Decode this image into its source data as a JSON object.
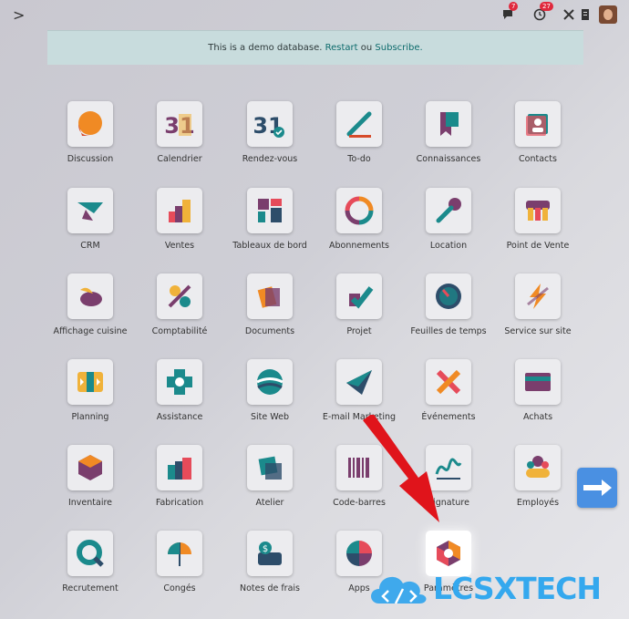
{
  "topbar": {
    "chat_badge": "7",
    "activity_badge": "27"
  },
  "demo_banner": {
    "text": "This is a demo database.",
    "link1": "Restart",
    "sep": "ou",
    "link2": "Subscribe."
  },
  "apps": [
    {
      "label": "Discussion",
      "icon": "discussion-icon"
    },
    {
      "label": "Calendrier",
      "icon": "calendar-icon"
    },
    {
      "label": "Rendez-vous",
      "icon": "appointment-icon"
    },
    {
      "label": "To-do",
      "icon": "todo-icon"
    },
    {
      "label": "Connaissances",
      "icon": "knowledge-icon"
    },
    {
      "label": "Contacts",
      "icon": "contacts-icon"
    },
    {
      "label": "CRM",
      "icon": "crm-icon"
    },
    {
      "label": "Ventes",
      "icon": "sales-icon"
    },
    {
      "label": "Tableaux de bord",
      "icon": "dashboard-icon"
    },
    {
      "label": "Abonnements",
      "icon": "subscription-icon"
    },
    {
      "label": "Location",
      "icon": "rental-icon"
    },
    {
      "label": "Point de Vente",
      "icon": "pos-icon"
    },
    {
      "label": "Affichage cuisine",
      "icon": "kitchen-icon"
    },
    {
      "label": "Comptabilité",
      "icon": "accounting-icon"
    },
    {
      "label": "Documents",
      "icon": "documents-icon"
    },
    {
      "label": "Projet",
      "icon": "project-icon"
    },
    {
      "label": "Feuilles de temps",
      "icon": "timesheet-icon"
    },
    {
      "label": "Service sur site",
      "icon": "field-service-icon"
    },
    {
      "label": "Planning",
      "icon": "planning-icon"
    },
    {
      "label": "Assistance",
      "icon": "helpdesk-icon"
    },
    {
      "label": "Site Web",
      "icon": "website-icon"
    },
    {
      "label": "E-mail Marketing",
      "icon": "email-marketing-icon"
    },
    {
      "label": "Événements",
      "icon": "events-icon"
    },
    {
      "label": "Achats",
      "icon": "purchase-icon"
    },
    {
      "label": "Inventaire",
      "icon": "inventory-icon"
    },
    {
      "label": "Fabrication",
      "icon": "manufacturing-icon"
    },
    {
      "label": "Atelier",
      "icon": "workshop-icon"
    },
    {
      "label": "Code-barres",
      "icon": "barcode-icon"
    },
    {
      "label": "Signature",
      "icon": "signature-icon"
    },
    {
      "label": "Employés",
      "icon": "employees-icon"
    },
    {
      "label": "Recrutement",
      "icon": "recruitment-icon"
    },
    {
      "label": "Congés",
      "icon": "time-off-icon"
    },
    {
      "label": "Notes de frais",
      "icon": "expenses-icon"
    },
    {
      "label": "Apps",
      "icon": "apps-icon"
    },
    {
      "label": "Paramètres",
      "icon": "settings-icon"
    }
  ],
  "watermark": {
    "text": "LCSXTECH"
  }
}
